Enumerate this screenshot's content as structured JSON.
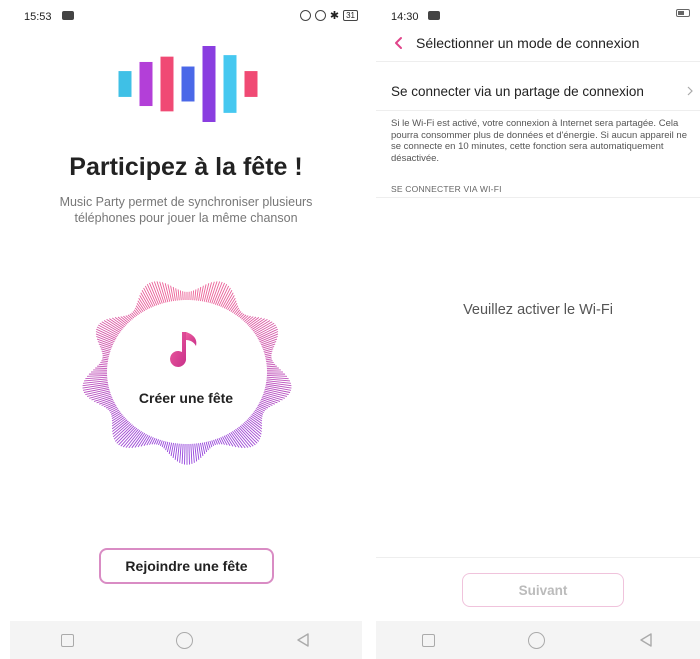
{
  "left": {
    "status": {
      "time": "15:53",
      "battery": "31"
    },
    "logo_bars": [
      {
        "h": 0.34,
        "color": "#3fc0e6"
      },
      {
        "h": 0.58,
        "color": "#b33fd8"
      },
      {
        "h": 0.72,
        "color": "#f04a74"
      },
      {
        "h": 0.46,
        "color": "#4a68e8"
      },
      {
        "h": 1.0,
        "color": "#8a3ee0"
      },
      {
        "h": 0.76,
        "color": "#46c8f0"
      },
      {
        "h": 0.34,
        "color": "#f04a74"
      }
    ],
    "title": "Participez à la fête !",
    "subtitle": "Music Party permet de synchroniser plusieurs téléphones pour jouer la même chanson",
    "create_label": "Créer une fête",
    "join_button": "Rejoindre une fête",
    "icons": [
      "music-note-icon",
      "wave-ring-icon"
    ],
    "colors": {
      "accent_pink": "#e0448a",
      "accent_purple": "#9b4fd9"
    }
  },
  "right": {
    "status": {
      "time": "14:30"
    },
    "header_title": "Sélectionner un mode de connexion",
    "hotspot_label": "Se connecter via un partage de connexion",
    "description": "Si le Wi-Fi est activé, votre connexion à Internet sera partagée. Cela pourra consommer plus de données et d'énergie. Si aucun appareil ne se connecte en 10 minutes, cette fonction sera automatiquement désactivée.",
    "section_header": "SE CONNECTER VIA WI-FI",
    "wifi_message": "Veuillez activer le Wi-Fi",
    "next_button": "Suivant"
  }
}
